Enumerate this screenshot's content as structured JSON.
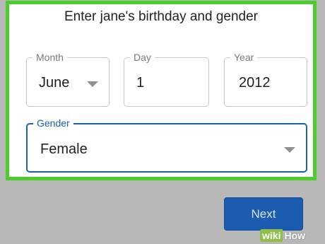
{
  "dialog": {
    "title": "Enter jane's birthday and gender"
  },
  "birthday": {
    "month": {
      "label": "Month",
      "value": "June"
    },
    "day": {
      "label": "Day",
      "value": "1"
    },
    "year": {
      "label": "Year",
      "value": "2012"
    }
  },
  "gender": {
    "label": "Gender",
    "value": "Female"
  },
  "actions": {
    "next_label": "Next"
  },
  "watermark": {
    "part1": "wiki",
    "part2": "How"
  },
  "colors": {
    "highlight_border": "#4ccd2c",
    "accent": "#1a5fb4",
    "button_bg": "#1b5cb0",
    "background": "#b8b8b8"
  }
}
